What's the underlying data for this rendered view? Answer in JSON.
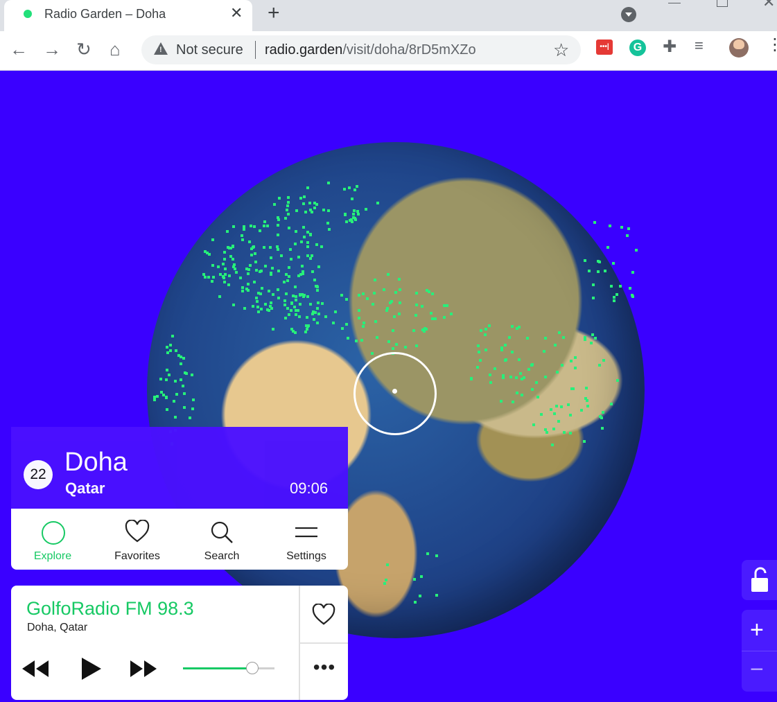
{
  "browser": {
    "tab_title": "Radio Garden – Doha",
    "tab_close": "✕",
    "new_tab": "+",
    "security_label": "Not secure",
    "url_host": "radio.garden",
    "url_path": "/visit/doha/8rD5mXZo"
  },
  "location": {
    "station_count": "22",
    "city": "Doha",
    "country": "Qatar",
    "local_time": "09:06"
  },
  "nav": {
    "items": [
      {
        "label": "Explore",
        "icon": "explore-circle-icon",
        "active": true
      },
      {
        "label": "Favorites",
        "icon": "heart-icon",
        "active": false
      },
      {
        "label": "Search",
        "icon": "search-icon",
        "active": false
      },
      {
        "label": "Settings",
        "icon": "menu-icon",
        "active": false
      }
    ]
  },
  "player": {
    "station_name": "GolfoRadio FM 98.3",
    "station_location": "Doha, Qatar",
    "volume_percent": 75,
    "more_label": "•••"
  },
  "colors": {
    "accent": "#17c964",
    "background": "#3a00ff",
    "panel": "#4a10ff"
  }
}
